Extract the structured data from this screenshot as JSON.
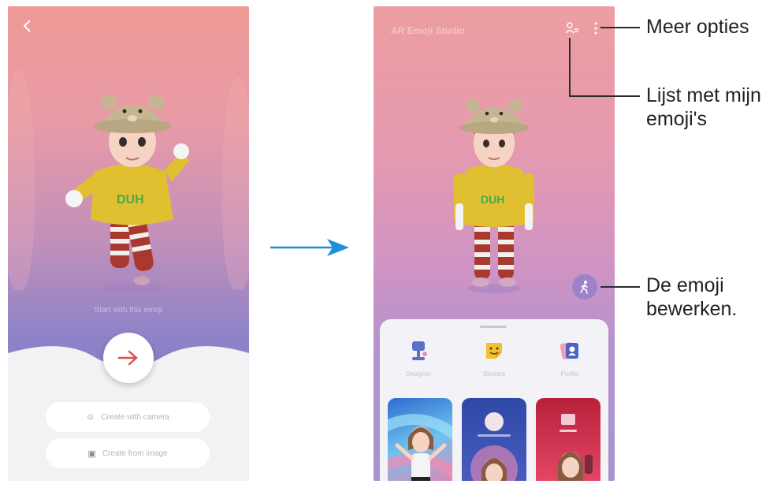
{
  "left_screen": {
    "start_text": "Start with this emoji",
    "create_camera_label": "Create with camera",
    "create_image_label": "Create from image",
    "colors": {
      "accent_arrow": "#e0504a"
    }
  },
  "right_screen": {
    "app_title": "AR Emoji Studio",
    "categories": [
      {
        "label": "Designer"
      },
      {
        "label": "Stickers"
      },
      {
        "label": "Profile"
      }
    ]
  },
  "callouts": {
    "more_options": "Meer opties",
    "list_line1": "Lijst met mijn",
    "list_line2": "emoji's",
    "edit_line1": "De emoji",
    "edit_line2": "bewerken."
  },
  "colors": {
    "flow_arrow": "#1f8fd6",
    "callout_line": "#2b2b2b"
  }
}
